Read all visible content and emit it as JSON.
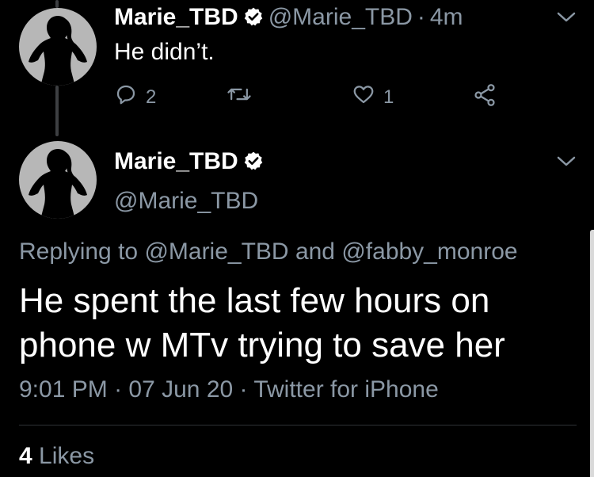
{
  "tweet1": {
    "name": "Marie_TBD",
    "handle": "@Marie_TBD",
    "separator": "·",
    "time": "4m",
    "text": "He didn’t.",
    "reply_count": "2",
    "retweet_count": "",
    "like_count": "1",
    "icons": {
      "reply": "reply-icon",
      "retweet": "retweet-icon",
      "like": "heart-icon",
      "share": "share-icon"
    }
  },
  "tweet2": {
    "name": "Marie_TBD",
    "handle": "@Marie_TBD",
    "replying_prefix": "Replying to",
    "replying_user1": "@Marie_TBD",
    "replying_and": "and",
    "replying_user2": "@fabby_monroe",
    "text": "He spent the last few hours on phone w MTv trying to save her",
    "time": "9:01 PM",
    "date": "07 Jun 20",
    "source": "Twitter for iPhone",
    "likes_count": "4",
    "likes_label": "Likes"
  },
  "colors": {
    "background": "#000000",
    "text": "#ffffff",
    "secondary": "#8b98a5",
    "avatar": "#b7b7b7"
  }
}
